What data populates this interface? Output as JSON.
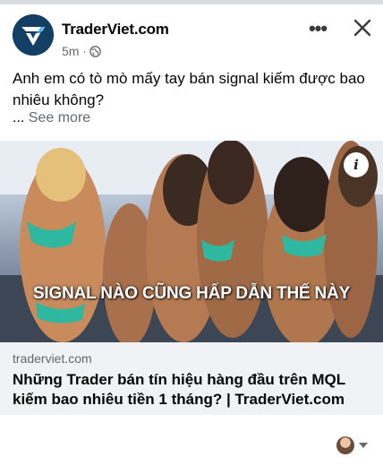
{
  "post": {
    "page_name": "TraderViet.com",
    "time": "5m",
    "separator": "·",
    "privacy_icon": "globe-icon",
    "text": "Anh em có tò mò mấy tay bán signal kiếm được bao nhiêu không?",
    "see_more_ellipsis": "...",
    "see_more": "See more",
    "more_icon": "•••",
    "close_icon": "close-icon"
  },
  "link_card": {
    "image_caption": "SIGNAL NÀO CŨNG HẤP DẪN THẾ NÀY",
    "info_icon": "i",
    "domain": "traderviet.com",
    "title": "Những Trader bán tín hiệu hàng đầu trên MQL kiếm bao nhiêu tiền 1 tháng? | TraderViet.com"
  },
  "colors": {
    "brand_navy": "#123f63",
    "secondary_text": "#65676b",
    "card_bg": "#f0f2f5"
  }
}
